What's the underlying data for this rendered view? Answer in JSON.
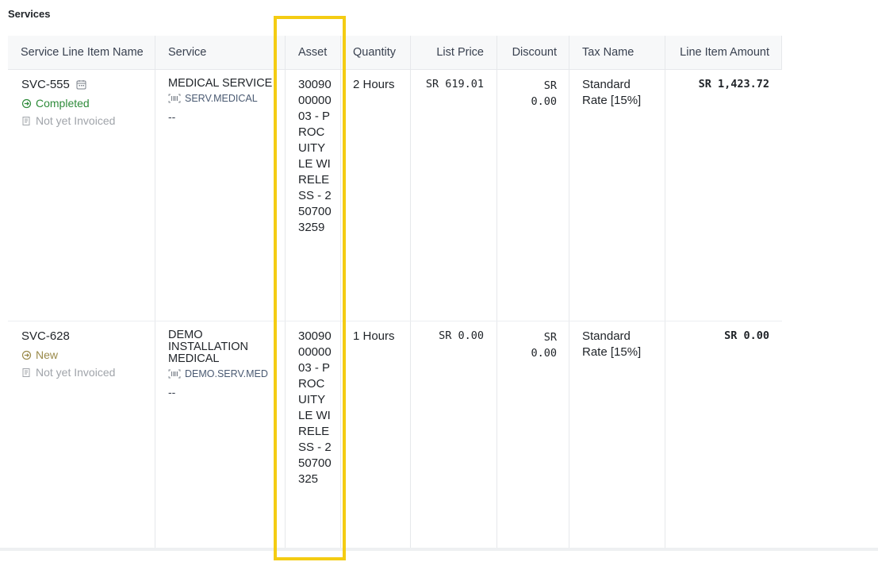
{
  "section": {
    "title": "Services"
  },
  "columns": {
    "name": "Service Line Item Name",
    "service": "Service",
    "asset": "Asset",
    "quantity": "Quantity",
    "list_price": "List Price",
    "discount": "Discount",
    "tax_name": "Tax Name",
    "amount": "Line Item Amount"
  },
  "rows": [
    {
      "id": "SVC-555",
      "status": "Completed",
      "invoice": "Not yet Invoiced",
      "service_name": "MEDICAL SERVICE",
      "service_code": "SERV.MEDICAL",
      "service_extra": "--",
      "asset": "300900000003 - PROCUITY LE WIRELESS - 2507003259",
      "quantity": "2 Hours",
      "list_price": "SR 619.01",
      "discount_currency": "SR",
      "discount_value": "0.00",
      "tax_line1": "Standard",
      "tax_line2": "Rate [15%]",
      "amount": "SR 1,423.72"
    },
    {
      "id": "SVC-628",
      "status": "New",
      "invoice": "Not yet Invoiced",
      "service_name": "DEMO INSTALLATION MEDICAL",
      "service_code": "DEMO.SERV.MED",
      "service_extra": "--",
      "asset": "300900000003 - PROCUITY LE WIRELESS - 250700325",
      "quantity": "1 Hours",
      "list_price": "SR 0.00",
      "discount_currency": "SR",
      "discount_value": "0.00",
      "tax_line1": "Standard",
      "tax_line2": "Rate [15%]",
      "amount": "SR 0.00"
    }
  ],
  "colors": {
    "highlight": "#f4cc13",
    "completed": "#2e8b3a",
    "new": "#9a8a4a",
    "muted": "#a0a4aa"
  }
}
